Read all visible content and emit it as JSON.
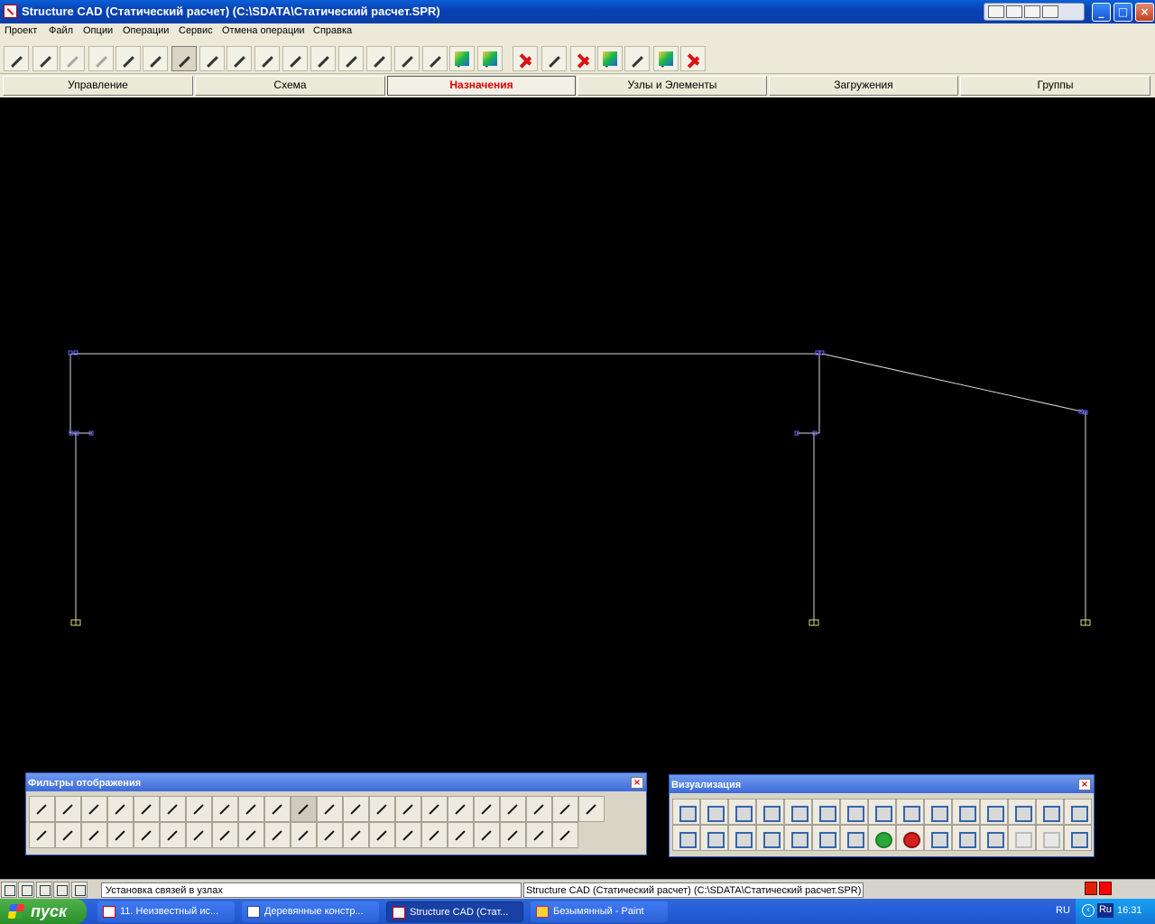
{
  "window": {
    "title": "Structure CAD (Статический расчет) (C:\\SDATA\\Статический расчет.SPR)"
  },
  "menu": {
    "items": [
      "Проект",
      "Файл",
      "Опции",
      "Операции",
      "Сервис",
      "Отмена операции",
      "Справка"
    ]
  },
  "tabs": [
    {
      "label": "Управление"
    },
    {
      "label": "Схема"
    },
    {
      "label": "Назначения",
      "selected": true
    },
    {
      "label": "Узлы и Элементы"
    },
    {
      "label": "Загружения"
    },
    {
      "label": "Группы"
    }
  ],
  "toolbar": {
    "selected_tool": "assign-support-icon"
  },
  "drawing": {
    "background": "#000000",
    "line_color": "#d9d9d9",
    "node_color": "#6666ff",
    "support_color": "#e0d77a"
  },
  "panels": {
    "filters": {
      "title": "Фильтры отображения",
      "close": "×"
    },
    "visualization": {
      "title": "Визуализация",
      "close": "×"
    }
  },
  "status": {
    "message": "Установка связей в узлах",
    "hint": "Structure CAD (Статический расчет) (C:\\SDATA\\Статический расчет.SPR)"
  },
  "taskbar": {
    "start": "пуск",
    "buttons": [
      {
        "label": "11. Неизвестный ис..."
      },
      {
        "label": "Деревянные констр..."
      },
      {
        "label": "Structure CAD (Стат...",
        "active": true
      },
      {
        "label": "Безымянный - Paint"
      }
    ],
    "language": "RU",
    "keyboard": "Ru",
    "clock": "16:31"
  }
}
